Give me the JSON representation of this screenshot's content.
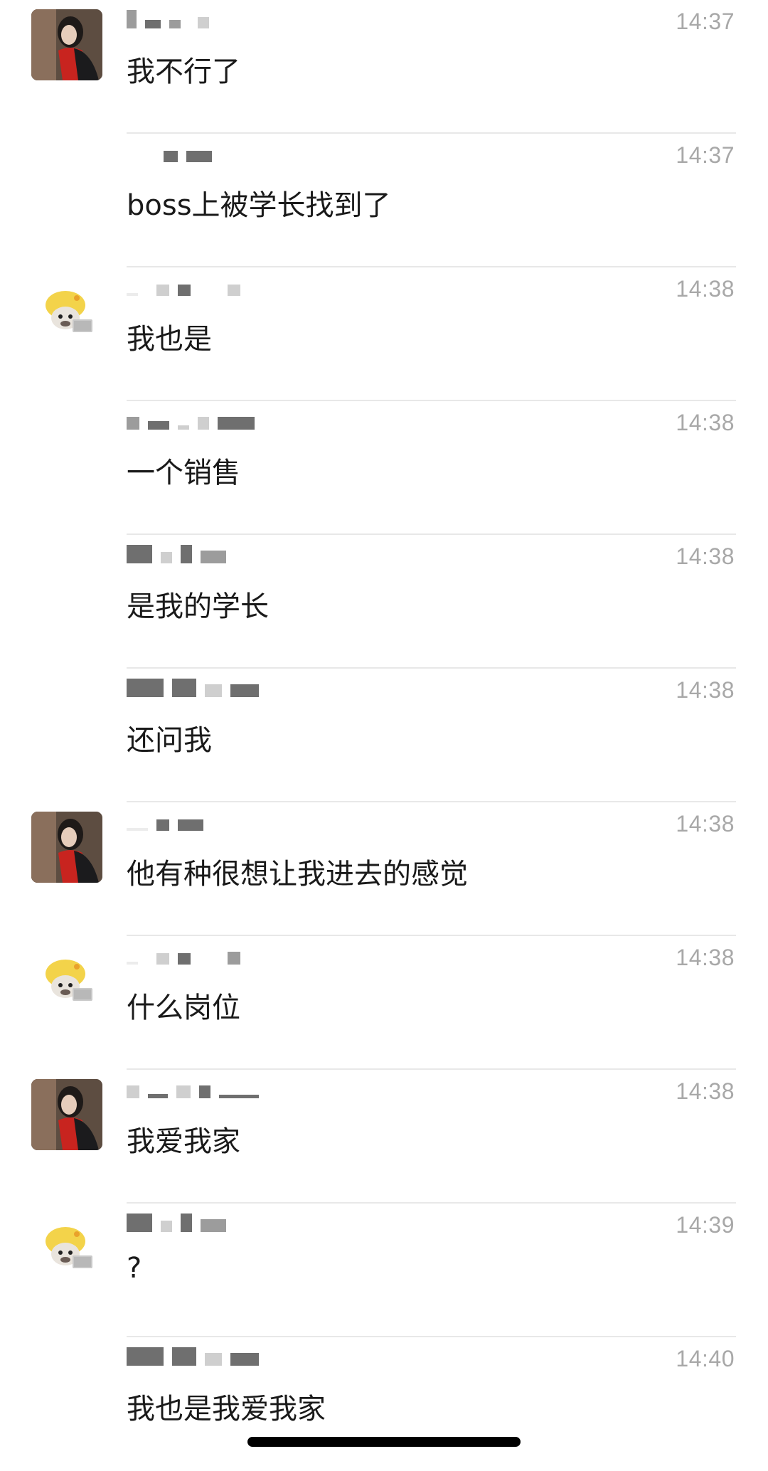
{
  "messages": [
    {
      "avatar": "girl-red-scarf-avatar",
      "time": "14:37",
      "text": "我不行了"
    },
    {
      "avatar": "",
      "time": "14:37",
      "text": "boss上被学长找到了"
    },
    {
      "avatar": "duck-hat-cat-avatar",
      "time": "14:38",
      "text": "我也是"
    },
    {
      "avatar": "",
      "time": "14:38",
      "text": "一个销售"
    },
    {
      "avatar": "",
      "time": "14:38",
      "text": "是我的学长"
    },
    {
      "avatar": "",
      "time": "14:38",
      "text": "还问我"
    },
    {
      "avatar": "girl-red-scarf-avatar",
      "time": "14:38",
      "text": "他有种很想让我进去的感觉"
    },
    {
      "avatar": "duck-hat-cat-avatar",
      "time": "14:38",
      "text": "什么岗位"
    },
    {
      "avatar": "girl-red-scarf-avatar",
      "time": "14:38",
      "text": "我爱我家"
    },
    {
      "avatar": "duck-hat-cat-avatar",
      "time": "14:39",
      "text": "?"
    },
    {
      "avatar": "",
      "time": "14:40",
      "text": "我也是我爱我家"
    }
  ],
  "colors": {
    "time_text": "#a8a8a8",
    "message_text": "#1a1a1a",
    "divider": "#e8e8e8",
    "scarf_red": "#c8241f",
    "duck_hat_yellow": "#f3d34a"
  }
}
